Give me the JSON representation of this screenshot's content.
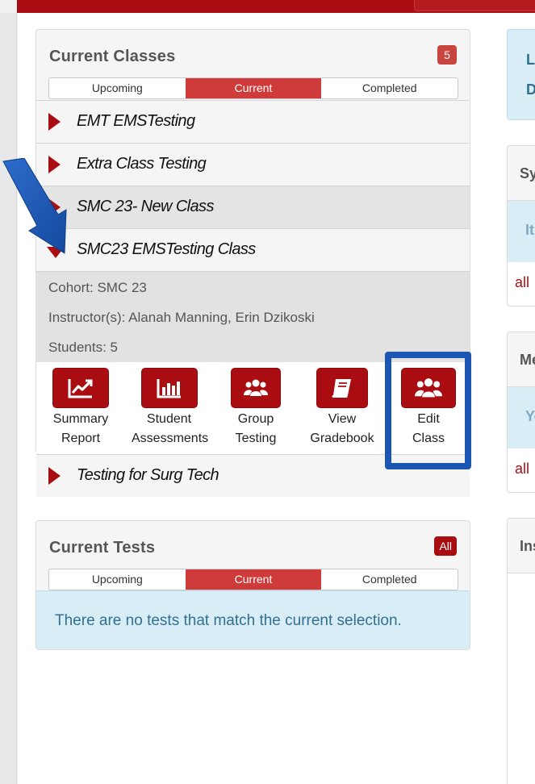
{
  "current_classes": {
    "title": "Current Classes",
    "count": "5",
    "segments": [
      "Upcoming",
      "Current",
      "Completed"
    ],
    "active_segment": "Current",
    "classes": [
      {
        "name": "EMT EMSTesting",
        "expanded": false
      },
      {
        "name": "Extra Class Testing",
        "expanded": false
      },
      {
        "name": "SMC 23- New Class",
        "expanded": false
      },
      {
        "name": "SMC23 EMSTesting Class",
        "expanded": true
      },
      {
        "name": "Testing for Surg Tech",
        "expanded": false
      }
    ],
    "details": {
      "cohort": "Cohort: SMC 23",
      "instructors": "Instructor(s): Alanah Manning, Erin Dzikoski",
      "students": "Students: 5"
    },
    "actions": [
      {
        "line1": "Summary",
        "line2": "Report",
        "icon": "line-chart-icon"
      },
      {
        "line1": "Student",
        "line2": "Assessments",
        "icon": "bar-chart-icon"
      },
      {
        "line1": "Group",
        "line2": "Testing",
        "icon": "users-icon"
      },
      {
        "line1": "View",
        "line2": "Gradebook",
        "icon": "book-icon"
      },
      {
        "line1": "Edit",
        "line2": "Class",
        "icon": "users-icon"
      }
    ]
  },
  "current_tests": {
    "title": "Current Tests",
    "badge": "All",
    "segments": [
      "Upcoming",
      "Current",
      "Completed"
    ],
    "active_segment": "Current",
    "empty_message": "There are no tests that match the current selection."
  },
  "right_column": {
    "info_line1": "L",
    "info_line2": "D",
    "panel1_header": "Sy",
    "panel1_sub": "It",
    "panel1_link": "all",
    "panel2_header": "Me",
    "panel2_sub": "Yo",
    "panel2_link": "all",
    "panel3_header": "Ins"
  },
  "colors": {
    "brand_red": "#a90d12",
    "active_segment": "#cf3a3a",
    "highlight_blue": "#1c56b3",
    "info_bg": "#d9edf7"
  }
}
